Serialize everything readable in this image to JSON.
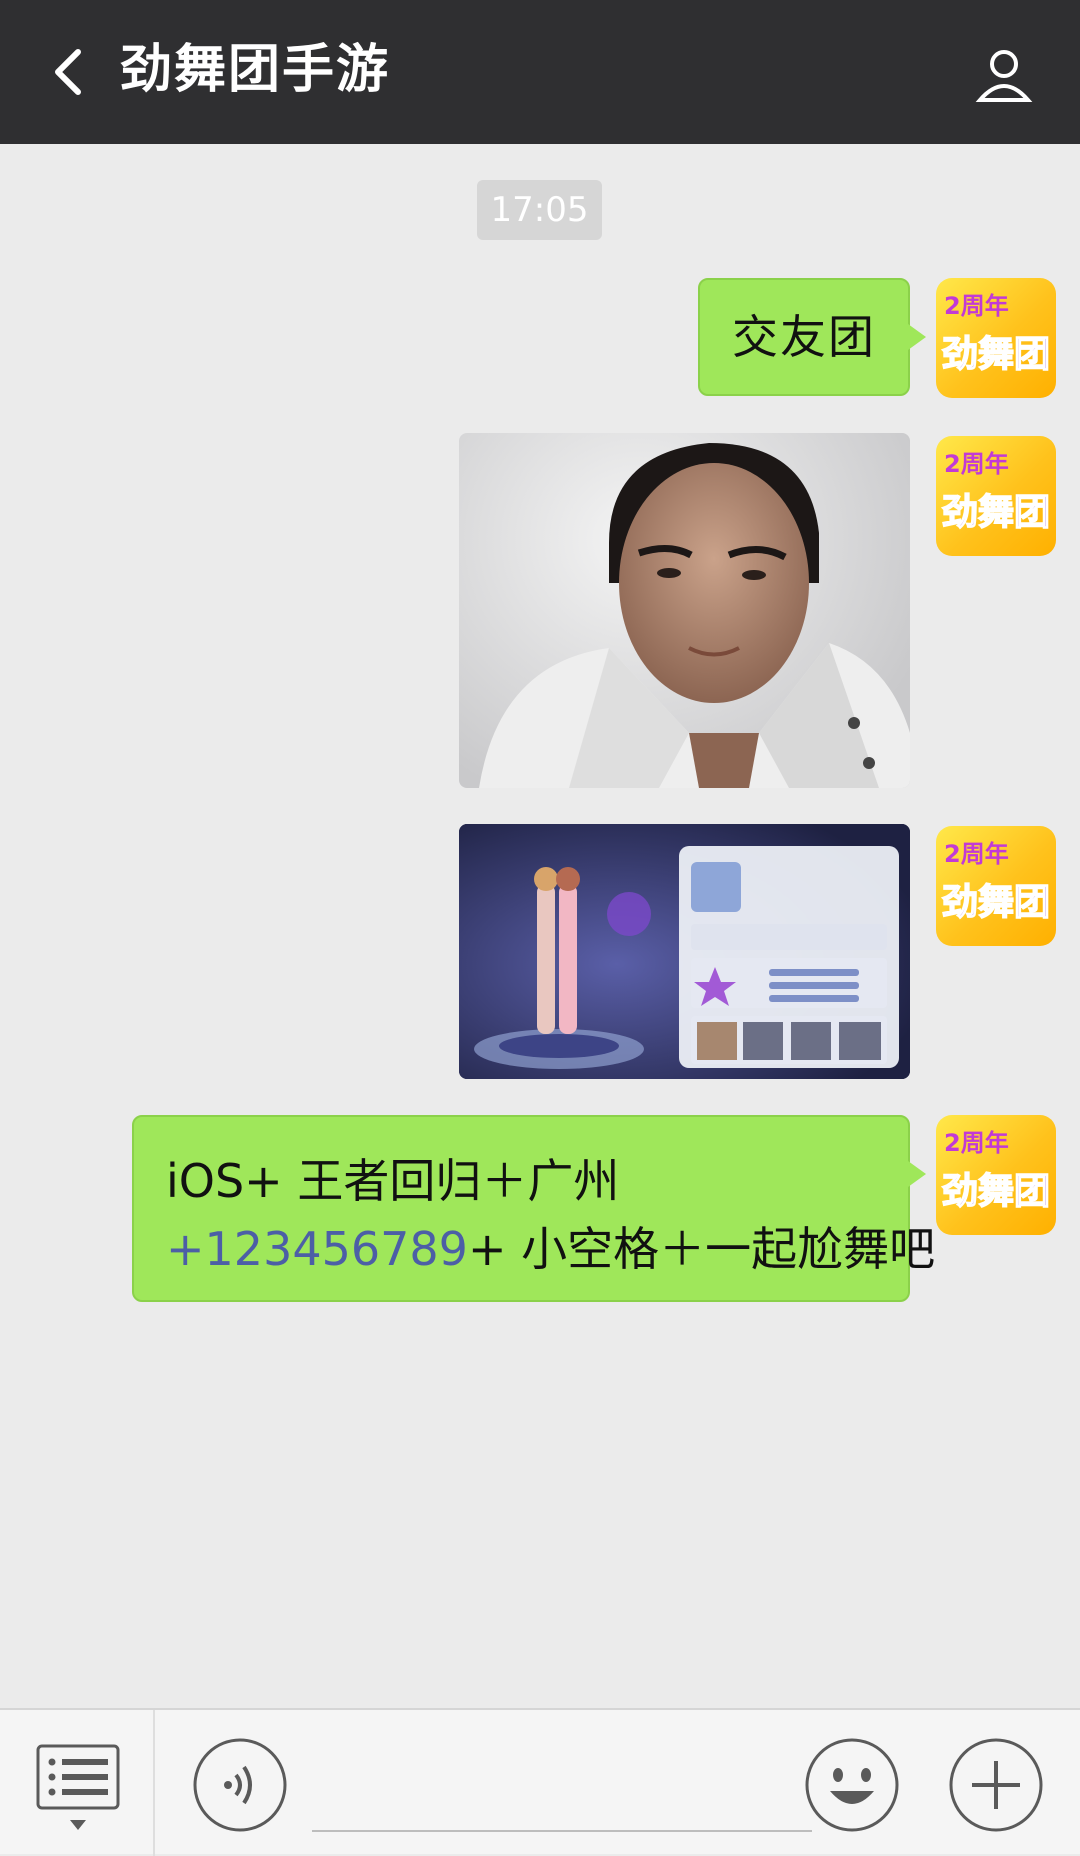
{
  "header": {
    "title": "劲舞团手游"
  },
  "chat": {
    "timestamp": "17:05",
    "messages": [
      {
        "type": "text",
        "text": "交友团"
      },
      {
        "type": "image"
      },
      {
        "type": "image"
      },
      {
        "type": "text",
        "line1": "iOS+ 王者回归＋广州",
        "phone": "+123456789",
        "line2_rest": "+ 小空格＋一起尬舞吧"
      }
    ]
  },
  "avatar": {
    "logo_top": "2周年",
    "logo_main": "劲舞团"
  },
  "icons": {
    "back": "back-arrow-icon",
    "profile": "person-icon",
    "menu": "menu-list-icon",
    "voice": "voice-icon",
    "emoji": "emoji-icon",
    "plus": "plus-icon"
  },
  "colors": {
    "header_bg": "#2f2f31",
    "bubble_green": "#9fe75a",
    "chat_bg": "#ebebeb",
    "link": "#4c5fa6"
  }
}
